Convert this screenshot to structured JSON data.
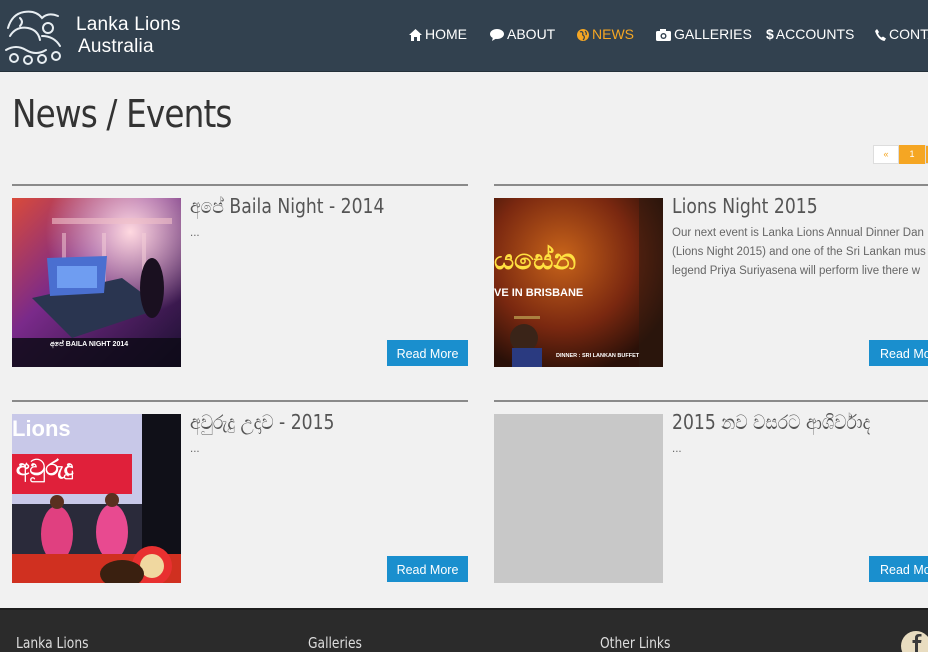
{
  "site": {
    "name_line1": "Lanka Lions",
    "name_line2": "Australia"
  },
  "nav": [
    {
      "label": "HOME",
      "icon": "home-icon"
    },
    {
      "label": "ABOUT",
      "icon": "speech-bubble-icon"
    },
    {
      "label": "NEWS",
      "icon": "globe-icon",
      "active": true
    },
    {
      "label": "GALLERIES",
      "icon": "camera-icon"
    },
    {
      "label": "ACCOUNTS",
      "icon": "dollar-icon"
    },
    {
      "label": "CONTA",
      "icon": "phone-icon"
    }
  ],
  "page": {
    "title": "News / Events"
  },
  "pagination": {
    "prev": "«",
    "current": "1"
  },
  "read_more_label": "Read More",
  "articles": [
    {
      "title": "අපේ Baila Night - 2014",
      "excerpt": "...",
      "thumb_caption": "අපේ BAILA NIGHT 2014"
    },
    {
      "title": "Lions Night 2015",
      "excerpt": "Our next event is Lanka Lions Annual Dinner Dan (Lions Night 2015) and one of the Sri Lankan mus legend Priya Suriyasena will perform live there w musicians from Melbourne. ...",
      "thumb_text_main": "යසේන",
      "thumb_text_sub": "VE IN BRISBANE",
      "thumb_footer": "DINNER : SRI LANKAN BUFFET"
    },
    {
      "title": "අවුරුදු උදාව - 2015",
      "excerpt": "...",
      "thumb_text_main": "Lions",
      "thumb_text_sub": "අවුරුදු"
    },
    {
      "title": "2015 නව වසරට ආශිර්වාද",
      "excerpt": "..."
    }
  ],
  "footer": {
    "col1": "Lanka Lions",
    "col2": "Galleries",
    "col3": "Other Links"
  },
  "colors": {
    "header": "#32414f",
    "active": "#f5a623",
    "button": "#1a8fce"
  }
}
